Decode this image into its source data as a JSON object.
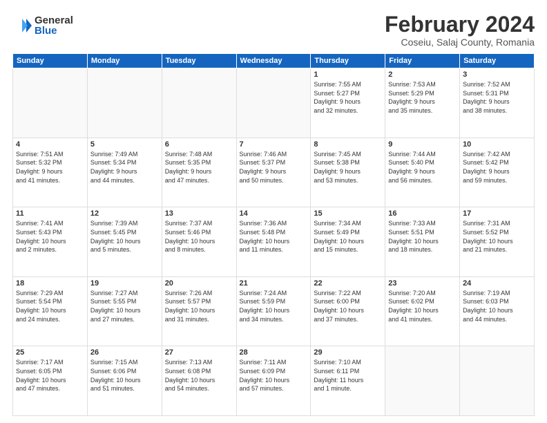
{
  "logo": {
    "general": "General",
    "blue": "Blue"
  },
  "header": {
    "month": "February 2024",
    "location": "Coseiu, Salaj County, Romania"
  },
  "days_of_week": [
    "Sunday",
    "Monday",
    "Tuesday",
    "Wednesday",
    "Thursday",
    "Friday",
    "Saturday"
  ],
  "weeks": [
    [
      {
        "day": "",
        "info": ""
      },
      {
        "day": "",
        "info": ""
      },
      {
        "day": "",
        "info": ""
      },
      {
        "day": "",
        "info": ""
      },
      {
        "day": "1",
        "info": "Sunrise: 7:55 AM\nSunset: 5:27 PM\nDaylight: 9 hours\nand 32 minutes."
      },
      {
        "day": "2",
        "info": "Sunrise: 7:53 AM\nSunset: 5:29 PM\nDaylight: 9 hours\nand 35 minutes."
      },
      {
        "day": "3",
        "info": "Sunrise: 7:52 AM\nSunset: 5:31 PM\nDaylight: 9 hours\nand 38 minutes."
      }
    ],
    [
      {
        "day": "4",
        "info": "Sunrise: 7:51 AM\nSunset: 5:32 PM\nDaylight: 9 hours\nand 41 minutes."
      },
      {
        "day": "5",
        "info": "Sunrise: 7:49 AM\nSunset: 5:34 PM\nDaylight: 9 hours\nand 44 minutes."
      },
      {
        "day": "6",
        "info": "Sunrise: 7:48 AM\nSunset: 5:35 PM\nDaylight: 9 hours\nand 47 minutes."
      },
      {
        "day": "7",
        "info": "Sunrise: 7:46 AM\nSunset: 5:37 PM\nDaylight: 9 hours\nand 50 minutes."
      },
      {
        "day": "8",
        "info": "Sunrise: 7:45 AM\nSunset: 5:38 PM\nDaylight: 9 hours\nand 53 minutes."
      },
      {
        "day": "9",
        "info": "Sunrise: 7:44 AM\nSunset: 5:40 PM\nDaylight: 9 hours\nand 56 minutes."
      },
      {
        "day": "10",
        "info": "Sunrise: 7:42 AM\nSunset: 5:42 PM\nDaylight: 9 hours\nand 59 minutes."
      }
    ],
    [
      {
        "day": "11",
        "info": "Sunrise: 7:41 AM\nSunset: 5:43 PM\nDaylight: 10 hours\nand 2 minutes."
      },
      {
        "day": "12",
        "info": "Sunrise: 7:39 AM\nSunset: 5:45 PM\nDaylight: 10 hours\nand 5 minutes."
      },
      {
        "day": "13",
        "info": "Sunrise: 7:37 AM\nSunset: 5:46 PM\nDaylight: 10 hours\nand 8 minutes."
      },
      {
        "day": "14",
        "info": "Sunrise: 7:36 AM\nSunset: 5:48 PM\nDaylight: 10 hours\nand 11 minutes."
      },
      {
        "day": "15",
        "info": "Sunrise: 7:34 AM\nSunset: 5:49 PM\nDaylight: 10 hours\nand 15 minutes."
      },
      {
        "day": "16",
        "info": "Sunrise: 7:33 AM\nSunset: 5:51 PM\nDaylight: 10 hours\nand 18 minutes."
      },
      {
        "day": "17",
        "info": "Sunrise: 7:31 AM\nSunset: 5:52 PM\nDaylight: 10 hours\nand 21 minutes."
      }
    ],
    [
      {
        "day": "18",
        "info": "Sunrise: 7:29 AM\nSunset: 5:54 PM\nDaylight: 10 hours\nand 24 minutes."
      },
      {
        "day": "19",
        "info": "Sunrise: 7:27 AM\nSunset: 5:55 PM\nDaylight: 10 hours\nand 27 minutes."
      },
      {
        "day": "20",
        "info": "Sunrise: 7:26 AM\nSunset: 5:57 PM\nDaylight: 10 hours\nand 31 minutes."
      },
      {
        "day": "21",
        "info": "Sunrise: 7:24 AM\nSunset: 5:59 PM\nDaylight: 10 hours\nand 34 minutes."
      },
      {
        "day": "22",
        "info": "Sunrise: 7:22 AM\nSunset: 6:00 PM\nDaylight: 10 hours\nand 37 minutes."
      },
      {
        "day": "23",
        "info": "Sunrise: 7:20 AM\nSunset: 6:02 PM\nDaylight: 10 hours\nand 41 minutes."
      },
      {
        "day": "24",
        "info": "Sunrise: 7:19 AM\nSunset: 6:03 PM\nDaylight: 10 hours\nand 44 minutes."
      }
    ],
    [
      {
        "day": "25",
        "info": "Sunrise: 7:17 AM\nSunset: 6:05 PM\nDaylight: 10 hours\nand 47 minutes."
      },
      {
        "day": "26",
        "info": "Sunrise: 7:15 AM\nSunset: 6:06 PM\nDaylight: 10 hours\nand 51 minutes."
      },
      {
        "day": "27",
        "info": "Sunrise: 7:13 AM\nSunset: 6:08 PM\nDaylight: 10 hours\nand 54 minutes."
      },
      {
        "day": "28",
        "info": "Sunrise: 7:11 AM\nSunset: 6:09 PM\nDaylight: 10 hours\nand 57 minutes."
      },
      {
        "day": "29",
        "info": "Sunrise: 7:10 AM\nSunset: 6:11 PM\nDaylight: 11 hours\nand 1 minute."
      },
      {
        "day": "",
        "info": ""
      },
      {
        "day": "",
        "info": ""
      }
    ]
  ]
}
